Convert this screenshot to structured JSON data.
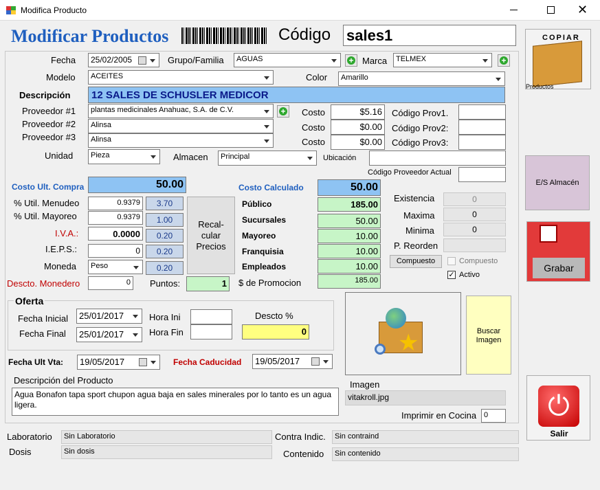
{
  "window": {
    "title": "Modifica Producto"
  },
  "header": {
    "title": "Modificar Productos",
    "codigo_label": "Código",
    "codigo_value": "sales1"
  },
  "fields": {
    "fecha_label": "Fecha",
    "fecha_value": "25/02/2005",
    "grupo_label": "Grupo/Familia",
    "grupo_value": "AGUAS",
    "marca_label": "Marca",
    "marca_value": "TELMEX",
    "modelo_label": "Modelo",
    "modelo_value": "ACEITES",
    "color_label": "Color",
    "color_value": "Amarillo",
    "descripcion_label": "Descripción",
    "descripcion_value": "12 SALES DE SCHUSLER MEDICOR",
    "prov1_label": "Proveedor #1",
    "prov1_value": "plantas medicinales Anahuac, S.A. de C.V.",
    "prov2_label": "Proveedor #2",
    "prov2_value": "Alinsa",
    "prov3_label": "Proveedor #3",
    "prov3_value": "Alinsa",
    "costo_label": "Costo",
    "costo1": "$5.16",
    "costo2": "$0.00",
    "costo3": "$0.00",
    "codprov1_label": "Código Prov1.",
    "codprov2_label": "Código Prov2:",
    "codprov3_label": "Código Prov3:",
    "unidad_label": "Unidad",
    "unidad_value": "Pieza",
    "almacen_label": "Almacen",
    "almacen_value": "Principal",
    "ubicacion_label": "Ubicación",
    "codprov_actual_label": "Código Proveedor Actual"
  },
  "costs": {
    "costo_ult_label": "Costo Ult. Compra",
    "costo_ult_value": "50.00",
    "menudeo_label": "% Util. Menudeo",
    "menudeo_value": "0.9379",
    "menudeo_pct": "3.70",
    "mayoreo_label": "% Util. Mayoreo",
    "mayoreo_value": "0.9379",
    "mayoreo_pct": "1.00",
    "iva_label": "I.V.A.:",
    "iva_value": "0.0000",
    "iva_pct": "0.20",
    "ieps_label": "I.E.P.S.:",
    "ieps_value": "0",
    "ieps_pct": "0.20",
    "moneda_label": "Moneda",
    "moneda_value": "Peso",
    "moneda_pct": "0.20",
    "descto_monedero_label": "Descto. Monedero",
    "descto_monedero_value": "0",
    "puntos_label": "Puntos:",
    "puntos_value": "1",
    "recalcular_label": "Recal-\ncular\nPrecios"
  },
  "prices": {
    "costo_calc_label": "Costo Calculado",
    "costo_calc_value": "50.00",
    "publico_label": "Público",
    "publico_value": "185.00",
    "sucursales_label": "Sucursales",
    "sucursales_value": "50.00",
    "mayoreo_label": "Mayoreo",
    "mayoreo_value": "10.00",
    "franquisia_label": "Franquisia",
    "franquisia_value": "10.00",
    "empleados_label": "Empleados",
    "empleados_value": "10.00",
    "promocion_label": "$  de Promocion",
    "promocion_value": "185.00"
  },
  "stock": {
    "existencia_label": "Existencia",
    "existencia_value": "0",
    "maxima_label": "Maxima",
    "maxima_value": "0",
    "minima_label": "Minima",
    "minima_value": "0",
    "reorden_label": "P. Reorden",
    "reorden_value": "",
    "compuesto_button": "Compuesto",
    "compuesto_check": "Compuesto",
    "activo_check": "Activo"
  },
  "oferta": {
    "title": "Oferta",
    "fecha_inicial_label": "Fecha Inicial",
    "fecha_inicial_value": "25/01/2017",
    "fecha_final_label": "Fecha Final",
    "fecha_final_value": "25/01/2017",
    "hora_ini_label": "Hora Ini",
    "hora_fin_label": "Hora Fin",
    "descto_label": "Descto %",
    "descto_value": "0"
  },
  "dates": {
    "ult_vta_label": "Fecha Ult Vta:",
    "ult_vta_value": "19/05/2017",
    "caducidad_label": "Fecha Caducidad",
    "caducidad_value": "19/05/2017"
  },
  "description": {
    "label": "Descripción del Producto",
    "text": "Agua Bonafon tapa sport chupon agua baja en sales minerales por lo tanto es un agua ligera."
  },
  "image": {
    "label": "Imagen",
    "file": "vitakroll.jpg",
    "buscar_label": "Buscar\nImagen"
  },
  "cocina": {
    "label": "Imprimir en Cocina",
    "value": "0"
  },
  "bottom": {
    "laboratorio_label": "Laboratorio",
    "laboratorio_value": "Sin Laboratorio",
    "dosis_label": "Dosis",
    "dosis_value": "Sin dosis",
    "contra_label": "Contra Indic.",
    "contra_value": "Sin contraind",
    "contenido_label": "Contenido",
    "contenido_value": "Sin contenido"
  },
  "side": {
    "copiar_label": "COPIAR",
    "productos_label": "Productos",
    "es_almacen_label": "E/S Almacén",
    "grabar_label": "Grabar",
    "salir_label": "Salir"
  },
  "colors": {
    "title_blue": "#1f5fbf",
    "label_red": "#c00000",
    "price_green": "#c7f5c7",
    "desc_blue": "#8ec3f3",
    "descto_yellow": "#ffff80",
    "buscar_yellow": "#ffffc0"
  }
}
